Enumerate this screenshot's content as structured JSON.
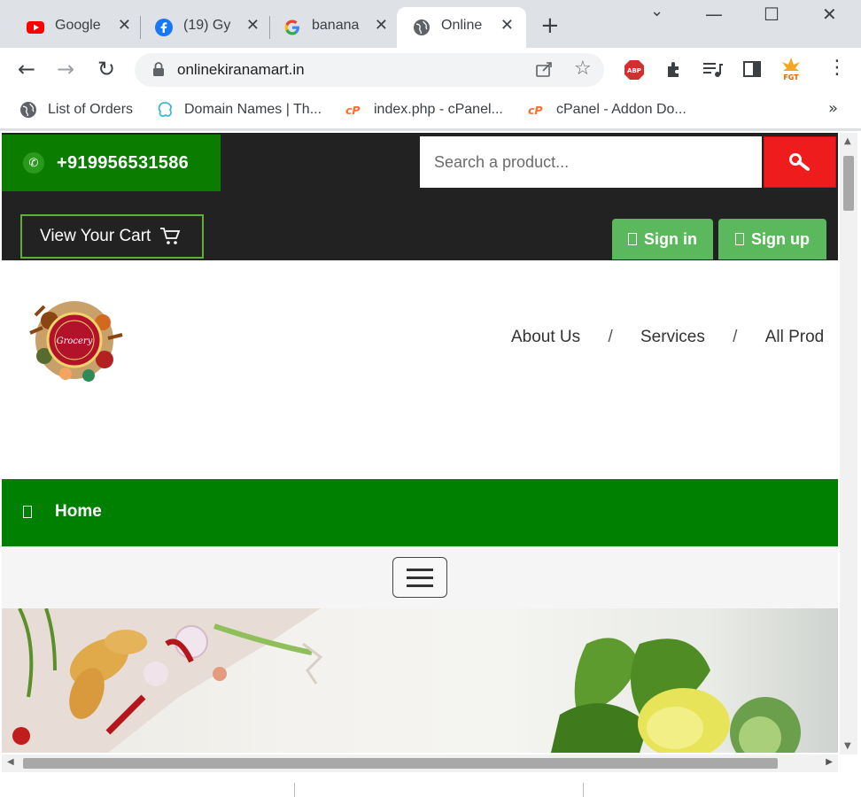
{
  "browser": {
    "tabs": [
      {
        "label": "Google",
        "icon": "youtube-icon",
        "active": false
      },
      {
        "label": "(19) Gy",
        "icon": "facebook-icon",
        "active": false
      },
      {
        "label": "banana",
        "icon": "google-icon",
        "active": false
      },
      {
        "label": "Online",
        "icon": "globe-icon",
        "active": true
      }
    ],
    "new_tab": "+",
    "window_controls": {
      "minimize": "—",
      "maximize": "☐",
      "close": "✕",
      "tab_search": "⌄"
    },
    "address": "onlinekiranamart.in",
    "bookmarks": [
      {
        "label": "List of Orders",
        "icon": "globe-icon"
      },
      {
        "label": "Domain Names | Th...",
        "icon": "domain-icon"
      },
      {
        "label": "index.php - cPanel...",
        "icon": "cpanel-icon"
      },
      {
        "label": "cPanel - Addon Do...",
        "icon": "cpanel-icon"
      }
    ],
    "bookmarks_more": "»",
    "colors": {
      "tabstrip": "#dee1e6",
      "omnibox": "#f1f3f4"
    }
  },
  "site": {
    "phone": "+919956531586",
    "search": {
      "placeholder": "Search a product..."
    },
    "cart_label": "View Your Cart",
    "signin_label": "Sign in",
    "signup_label": "Sign up",
    "logo_text": "Grocery",
    "nav": {
      "about": "About Us",
      "sep1": "/",
      "services": "Services",
      "sep2": "/",
      "all": "All Prod"
    },
    "home_label": "Home",
    "colors": {
      "green": "#008000",
      "phone_green": "#0a7d00",
      "search_red": "#ee1c1c",
      "auth_green": "#5cb85c",
      "dark": "#222222"
    }
  }
}
